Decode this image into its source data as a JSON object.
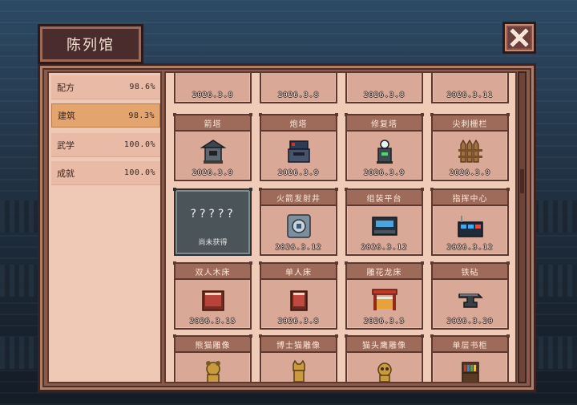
{
  "window": {
    "title": "陈列馆",
    "close_label": "✕"
  },
  "sidebar": {
    "categories": [
      {
        "name": "配方",
        "percent": "98.6%",
        "active": false
      },
      {
        "name": "建筑",
        "percent": "98.3%",
        "active": true
      },
      {
        "name": "武学",
        "percent": "100.0%",
        "active": false
      },
      {
        "name": "成就",
        "percent": "100.0%",
        "active": false
      }
    ]
  },
  "grid": {
    "partial_row": [
      {
        "icon": "wood-floor-icon",
        "date": "2026.3.8"
      },
      {
        "icon": "brick-wall-icon",
        "date": "2026.3.8"
      },
      {
        "icon": "stone-floor-icon",
        "date": "2026.3.8"
      },
      {
        "icon": "tile-floor-icon",
        "date": "2026.3.11"
      }
    ],
    "rows": [
      [
        {
          "name": "箭塔",
          "icon": "arrow-tower-icon",
          "date": "2026.3.9"
        },
        {
          "name": "炮塔",
          "icon": "cannon-tower-icon",
          "date": "2026.3.9"
        },
        {
          "name": "修复塔",
          "icon": "repair-tower-icon",
          "date": "2026.3.9"
        },
        {
          "name": "尖刺栅栏",
          "icon": "spike-fence-icon",
          "date": "2026.3.9"
        }
      ],
      [
        {
          "locked": true,
          "name": "?????",
          "status": "尚未获得"
        },
        {
          "name": "火箭发射井",
          "icon": "rocket-silo-icon",
          "date": "2026.3.12"
        },
        {
          "name": "组装平台",
          "icon": "assembly-platform-icon",
          "date": "2026.3.12"
        },
        {
          "name": "指挥中心",
          "icon": "command-center-icon",
          "date": "2026.3.12"
        }
      ],
      [
        {
          "name": "双人木床",
          "icon": "double-wood-bed-icon",
          "date": "2026.3.15"
        },
        {
          "name": "单人床",
          "icon": "single-bed-icon",
          "date": "2026.3.8"
        },
        {
          "name": "雕花龙床",
          "icon": "dragon-bed-icon",
          "date": "2026.3.5"
        },
        {
          "name": "铁砧",
          "icon": "anvil-icon",
          "date": "2026.3.20"
        }
      ],
      [
        {
          "name": "熊猫雕像",
          "icon": "panda-statue-icon"
        },
        {
          "name": "博士猫雕像",
          "icon": "doctor-cat-statue-icon"
        },
        {
          "name": "猫头鹰雕像",
          "icon": "owl-statue-icon"
        },
        {
          "name": "单层书柜",
          "icon": "bookshelf-icon"
        }
      ]
    ]
  },
  "colors": {
    "panel": "#8c5a48",
    "card": "#d9a896",
    "card_header": "#9e6a5a",
    "active_tab": "#e3a56d",
    "locked_card": "#4b5458"
  }
}
